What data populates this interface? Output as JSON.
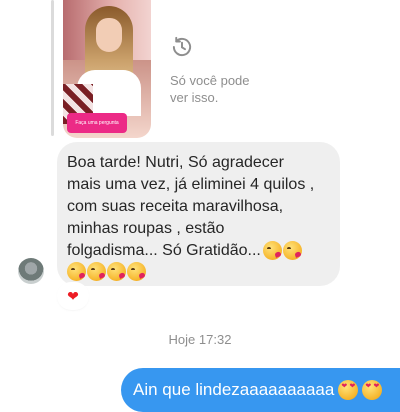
{
  "story_reply": {
    "thumbnail_cta": "Faça uma pergunta",
    "visibility_note": "Só você pode ver isso."
  },
  "incoming_message": {
    "text": "Boa tarde! Nutri, Só agradecer\nmais uma vez, já eliminei 4 quilos ,\ncom suas receita maravilhosa,\nminhas roupas , estão\nfolgadisma... Só Gratidão...",
    "emoji_inline": [
      "kissing-heart",
      "kissing-heart"
    ],
    "emoji_row": [
      "kissing-heart",
      "kissing-heart",
      "kissing-heart",
      "kissing-heart"
    ],
    "reaction": "❤"
  },
  "timestamp": "Hoje 17:32",
  "outgoing_message": {
    "text": "Ain que lindezaaaaaaaaaa",
    "emoji": [
      "heart-eyes",
      "heart-eyes"
    ]
  },
  "colors": {
    "outgoing_bubble": "#3797f0",
    "incoming_bubble": "#efefef",
    "muted_text": "#8e8e8e",
    "reaction_heart": "#ed1c24"
  }
}
